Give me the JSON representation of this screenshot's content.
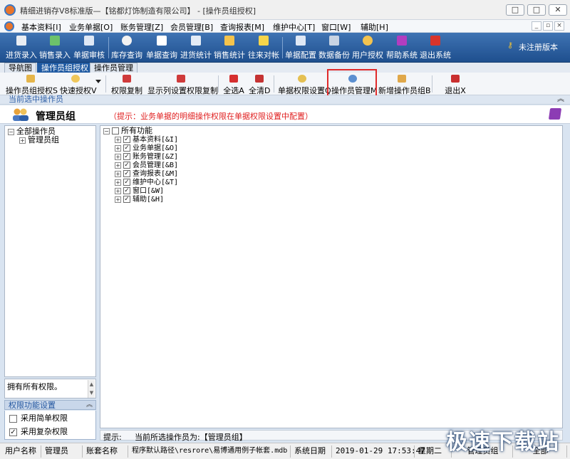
{
  "window": {
    "title": "精细进销存V8标准版—【铭都灯饰制造有限公司】 - [操作员组授权]",
    "buttons": {
      "minimize": "□",
      "maximize": "□",
      "close": "✕"
    }
  },
  "menubar": {
    "items": [
      "基本资料[I]",
      "业务单据[O]",
      "账务管理[Z]",
      "会员管理[B]",
      "查询报表[M]",
      "维护中心[T]",
      "窗口[W]",
      "辅助[H]"
    ],
    "mdi_buttons": [
      "_",
      "▫",
      "×"
    ]
  },
  "toolbar": {
    "items": [
      "进货录入",
      "销售录入",
      "单据审核",
      "库存查询",
      "单据查询",
      "进货统计",
      "销售统计",
      "往来对帐",
      "单据配置",
      "数据备份",
      "用户授权",
      "帮助系统",
      "退出系统"
    ],
    "registration": "未注册版本"
  },
  "tabs": [
    "导航图",
    "操作员组授权",
    "操作员管理"
  ],
  "subtoolbar": {
    "items": [
      "操作员组授权S",
      "快速授权V",
      "权限复制",
      "显示列设置权限复制",
      "全选A",
      "全清D",
      "单据权限设置Q",
      "操作员管理M",
      "新增操作员组B",
      "退出X"
    ]
  },
  "selection_strip": {
    "label": "当前选中操作员",
    "arrow": "︽"
  },
  "header": {
    "title": "管理员组",
    "hint": "（提示：业务单据的明细操作权限在单据权限设置中配置）"
  },
  "left_tree": {
    "root": "全部操作员",
    "child": "管理员组",
    "root_toggle": "−",
    "child_toggle": "+"
  },
  "left_note": "拥有所有权限。",
  "perm_settings": {
    "title": "权限功能设置",
    "arrow": "︽",
    "options": [
      {
        "label": "采用简单权限",
        "mark": ""
      },
      {
        "label": "采用复杂权限",
        "mark": "✓"
      }
    ]
  },
  "right_tree": {
    "root": "所有功能",
    "root_toggle": "−",
    "items": [
      {
        "label": "基本资料[&I]",
        "mark": "✓",
        "toggle": "+"
      },
      {
        "label": "业务单据[&O]",
        "mark": "✓",
        "toggle": "+"
      },
      {
        "label": "账务管理[&Z]",
        "mark": "✓",
        "toggle": "+"
      },
      {
        "label": "会员管理[&B]",
        "mark": "✓",
        "toggle": "+"
      },
      {
        "label": "查询报表[&M]",
        "mark": "✓",
        "toggle": "+"
      },
      {
        "label": "维护中心[&T]",
        "mark": "✓",
        "toggle": "+"
      },
      {
        "label": "窗口[&W]",
        "mark": "✓",
        "toggle": "+"
      },
      {
        "label": "辅助[&H]",
        "mark": "✓",
        "toggle": "+"
      }
    ]
  },
  "hint_bar": {
    "label": "提示:",
    "text": "当前所选操作员为:【管理员组】"
  },
  "status": {
    "user_label": "用户名称",
    "user": "管理员",
    "account_label": "账套名称",
    "path": "程序默认路径\\resrore\\易博通用例子帐套.mdb",
    "date_label": "系统日期",
    "datetime": "2019-01-29  17:53:47",
    "weekday": "星期二",
    "group": "管理员组",
    "all": "全部"
  },
  "watermark": "极速下载站",
  "colors": {
    "toolbar": "#2a5d9f",
    "tab_active": "#1f5aa2",
    "hint_red": "#e01e1e",
    "highlight": "#e02b2b"
  }
}
